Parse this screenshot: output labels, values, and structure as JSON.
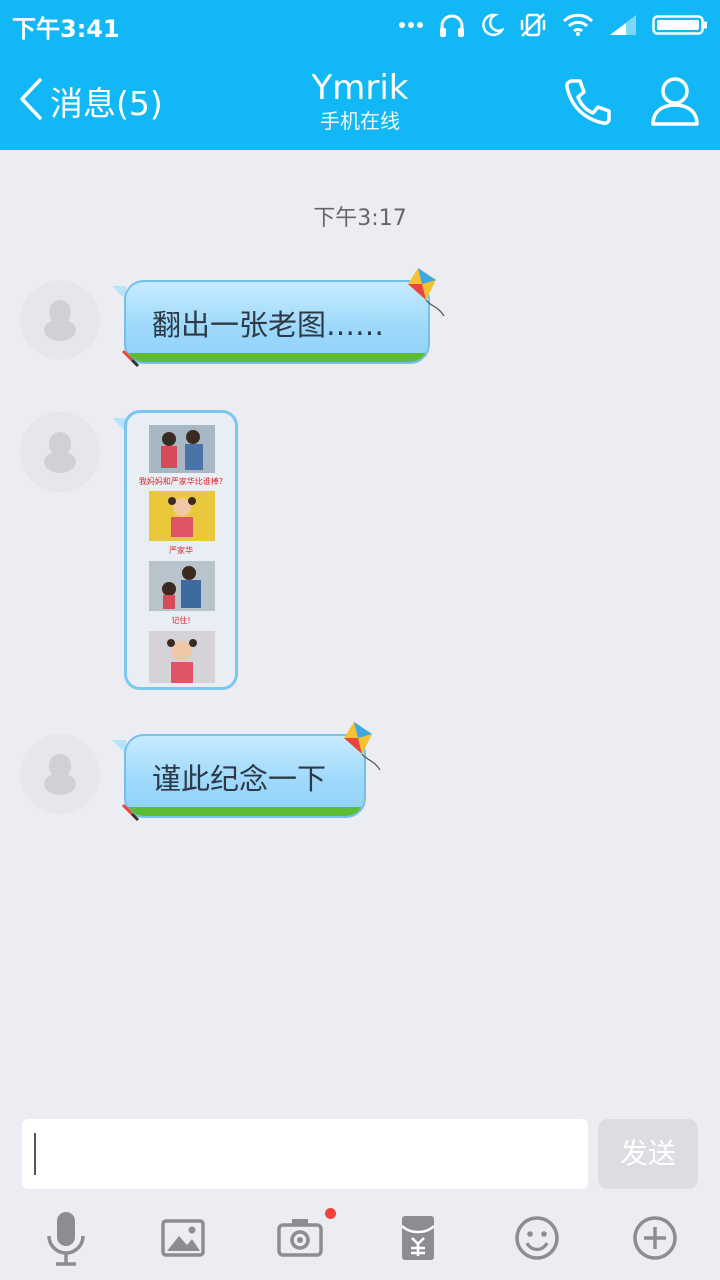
{
  "status_bar": {
    "time": "下午3:41",
    "icons": [
      "more-dots-icon",
      "headphones-icon",
      "moon-icon",
      "vibrate-off-icon",
      "wifi-icon",
      "signal-icon",
      "battery-icon"
    ]
  },
  "header": {
    "back_label": "消息(5)",
    "title": "Ymrik",
    "subtitle": "手机在线",
    "actions": [
      "phone-icon",
      "profile-icon"
    ]
  },
  "chat": {
    "timestamp": "下午3:17",
    "messages": [
      {
        "type": "text",
        "text": "翻出一张老图……"
      },
      {
        "type": "image",
        "captions": [
          "我妈妈和严家华比谁棒?",
          "严家华",
          "记住!"
        ]
      },
      {
        "type": "text",
        "text": "谨此纪念一下"
      }
    ]
  },
  "composer": {
    "input_value": "",
    "send_label": "发送",
    "tools": [
      "microphone-icon",
      "picture-icon",
      "camera-icon",
      "red-packet-icon",
      "emoji-icon",
      "plus-icon"
    ],
    "camera_has_badge": true
  },
  "colors": {
    "brand": "#12b7f5",
    "background": "#ebedf2",
    "bubble": "#9fd9fb",
    "grass": "#5cbc32",
    "badge": "#f0443c"
  }
}
